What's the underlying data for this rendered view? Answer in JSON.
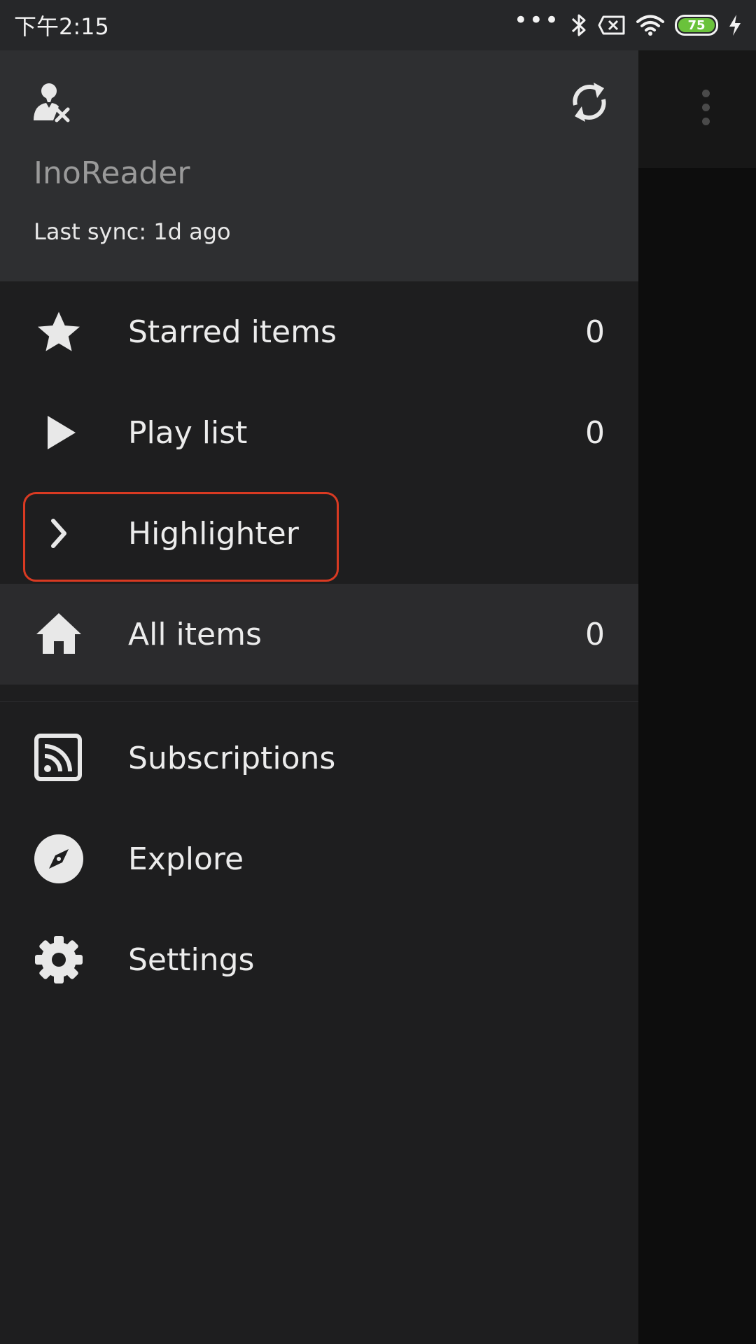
{
  "status_bar": {
    "time": "下午2:15",
    "battery_level": "75",
    "icons": [
      "more-dots-icon",
      "bluetooth-icon",
      "sim-off-icon",
      "wifi-icon",
      "battery-icon",
      "charging-icon"
    ]
  },
  "drawer": {
    "app_name": "InoReader",
    "last_sync": "Last sync: 1d ago",
    "header_icons": {
      "account": "account-remove-icon",
      "sync": "sync-icon"
    },
    "items": [
      {
        "label": "Starred items",
        "count": "0",
        "icon": "star-icon"
      },
      {
        "label": "Play list",
        "count": "0",
        "icon": "play-icon"
      },
      {
        "label": "Highlighter",
        "count": "",
        "icon": "chevron-right-icon"
      },
      {
        "label": "All items",
        "count": "0",
        "icon": "home-icon"
      }
    ],
    "secondary_items": [
      {
        "label": "Subscriptions",
        "icon": "rss-icon"
      },
      {
        "label": "Explore",
        "icon": "compass-icon"
      },
      {
        "label": "Settings",
        "icon": "gear-icon"
      }
    ]
  },
  "colors": {
    "status_bar": "#262729",
    "drawer_header": "#2e2f31",
    "drawer_body": "#1e1e1f",
    "selected_row": "#2b2b2d",
    "highlight_outline": "#d93a22",
    "battery_fill": "#6ac23b"
  }
}
